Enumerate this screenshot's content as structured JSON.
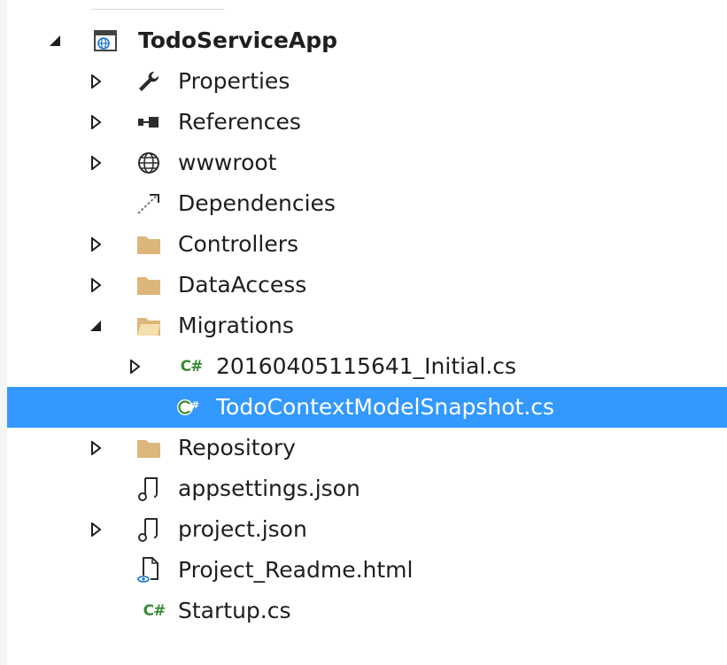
{
  "colors": {
    "selection": "#3399ff",
    "folder": "#dcb67a",
    "csharp": "#388a34",
    "text": "#1e1e1e"
  },
  "tree": {
    "project": {
      "label": "TodoServiceApp",
      "icon": "web-project-icon",
      "expanded": true
    },
    "items": [
      {
        "label": "Properties",
        "icon": "wrench-icon",
        "expandable": true,
        "expanded": false
      },
      {
        "label": "References",
        "icon": "references-icon",
        "expandable": true,
        "expanded": false
      },
      {
        "label": "wwwroot",
        "icon": "globe-icon",
        "expandable": true,
        "expanded": false
      },
      {
        "label": "Dependencies",
        "icon": "dependencies-icon",
        "expandable": false
      },
      {
        "label": "Controllers",
        "icon": "folder-icon",
        "expandable": true,
        "expanded": false
      },
      {
        "label": "DataAccess",
        "icon": "folder-icon",
        "expandable": true,
        "expanded": false
      },
      {
        "label": "Migrations",
        "icon": "folder-open-icon",
        "expandable": true,
        "expanded": true
      },
      {
        "label": "20160405115641_Initial.cs",
        "icon": "csharp-file-icon",
        "icon_text": "C#",
        "expandable": true,
        "expanded": false
      },
      {
        "label": "TodoContextModelSnapshot.cs",
        "icon": "csharp-class-icon",
        "icon_text": "C#",
        "expandable": false,
        "selected": true
      },
      {
        "label": "Repository",
        "icon": "folder-icon",
        "expandable": true,
        "expanded": false
      },
      {
        "label": "appsettings.json",
        "icon": "json-file-icon",
        "expandable": false
      },
      {
        "label": "project.json",
        "icon": "json-file-icon",
        "expandable": true,
        "expanded": false
      },
      {
        "label": "Project_Readme.html",
        "icon": "html-file-icon",
        "expandable": false
      },
      {
        "label": "Startup.cs",
        "icon": "csharp-file-icon",
        "icon_text": "C#",
        "expandable": false
      }
    ]
  }
}
